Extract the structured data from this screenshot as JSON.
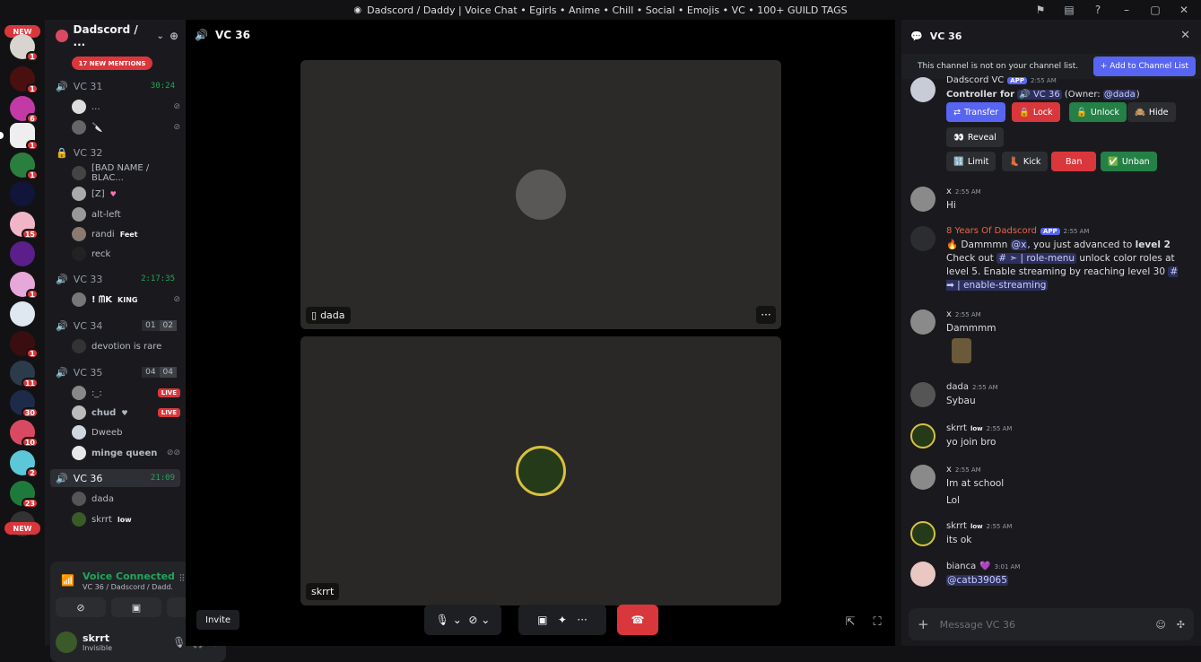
{
  "window": {
    "title": "Dadscord / Daddy | Voice Chat • Egirls • Anime • Chill • Social • Emojis • VC • 100+ GUILD TAGS"
  },
  "guilds": {
    "new_label": "NEW",
    "new_label_bottom": "NEW",
    "badges": [
      "1",
      "1",
      "6",
      "1",
      "1",
      "15",
      "1",
      "1",
      "1",
      "11",
      "30",
      "10",
      "2",
      "23"
    ]
  },
  "server": {
    "name": "Dadscord / ...",
    "mentions_pill": "17 NEW MENTIONS"
  },
  "channels": [
    {
      "name": "VC 31",
      "timer": "30:24",
      "members": [
        {
          "name": "..."
        },
        {
          "name": "🔪"
        }
      ]
    },
    {
      "name": "VC 32",
      "locked": true,
      "members": [
        {
          "name": "[BAD NAME / BLAC..."
        },
        {
          "name": "[Z]"
        },
        {
          "name": "alt-left"
        },
        {
          "name": "randi",
          "tag": "Feet"
        },
        {
          "name": "reck"
        }
      ]
    },
    {
      "name": "VC 33",
      "timer": "2:17:35",
      "members": [
        {
          "name": "! ᗰK",
          "tag": "KING"
        }
      ]
    },
    {
      "name": "VC 34",
      "count_a": "01",
      "count_b": "02",
      "members": [
        {
          "name": "devotion is rare"
        }
      ]
    },
    {
      "name": "VC 35",
      "count_a": "04",
      "count_b": "04",
      "members": [
        {
          "name": ":_:",
          "live": "LIVE"
        },
        {
          "name": "chud",
          "live": "LIVE"
        },
        {
          "name": "Dweeb"
        },
        {
          "name": "minge queen"
        }
      ]
    },
    {
      "name": "VC 36",
      "timer": "21:09",
      "members": [
        {
          "name": "dada"
        },
        {
          "name": "skrrt",
          "tag": "low"
        }
      ]
    }
  ],
  "voice": {
    "status": "Voice Connected",
    "sub": "VC 36 / Dadscord / Dadd..."
  },
  "user": {
    "name": "skrrt",
    "status": "Invisible"
  },
  "main": {
    "channel": "VC 36",
    "tile1_label": "dada",
    "tile2_label": "skrrt",
    "invite": "Invite",
    "more": "···"
  },
  "chat": {
    "header": "VC 36",
    "notice": "This channel is not on your channel list.",
    "add_button": "Add to Channel List",
    "controller": {
      "author": "Dadscord VC",
      "app": "APP",
      "time": "2:55 AM",
      "line_prefix": "Controller for",
      "channel": "VC 36",
      "owner_prefix": "(Owner:",
      "owner": "@dada",
      "owner_suffix": ")",
      "buttons": [
        "Transfer",
        "Lock",
        "Unlock",
        "Hide",
        "Reveal",
        "Limit",
        "Kick",
        "Ban",
        "Unban"
      ]
    },
    "messages": [
      {
        "author": "x",
        "time": "2:55 AM",
        "lines": [
          "Hi"
        ]
      },
      {
        "author": "8 Years Of Dadscord",
        "app": "APP",
        "time": "2:55 AM",
        "text_a": "Dammmn",
        "mention": "@x",
        "text_b": ", you just advanced to",
        "level": "level 2",
        "line2a": "Check out",
        "chan1": "# ➣ | role-menu",
        "line2b": "unlock color roles at",
        "line3a": "level 5. Enable streaming by reaching level 30",
        "chan2": "# ➡ | enable-streaming"
      },
      {
        "author": "x",
        "time": "2:55 AM",
        "lines": [
          "Dammmm"
        ]
      },
      {
        "author": "dada",
        "time": "2:55 AM",
        "lines": [
          "Sybau"
        ]
      },
      {
        "author": "skrrt",
        "tag": "low",
        "time": "2:55 AM",
        "lines": [
          "yo join bro"
        ]
      },
      {
        "author": "x",
        "time": "2:55 AM",
        "lines": [
          "Im at school",
          "Lol"
        ]
      },
      {
        "author": "skrrt",
        "tag": "low",
        "time": "2:55 AM",
        "lines": [
          "its ok"
        ]
      },
      {
        "author": "bianca",
        "time": "3:01 AM",
        "mention": "@catb39065"
      }
    ],
    "composer_placeholder": "Message VC 36"
  }
}
